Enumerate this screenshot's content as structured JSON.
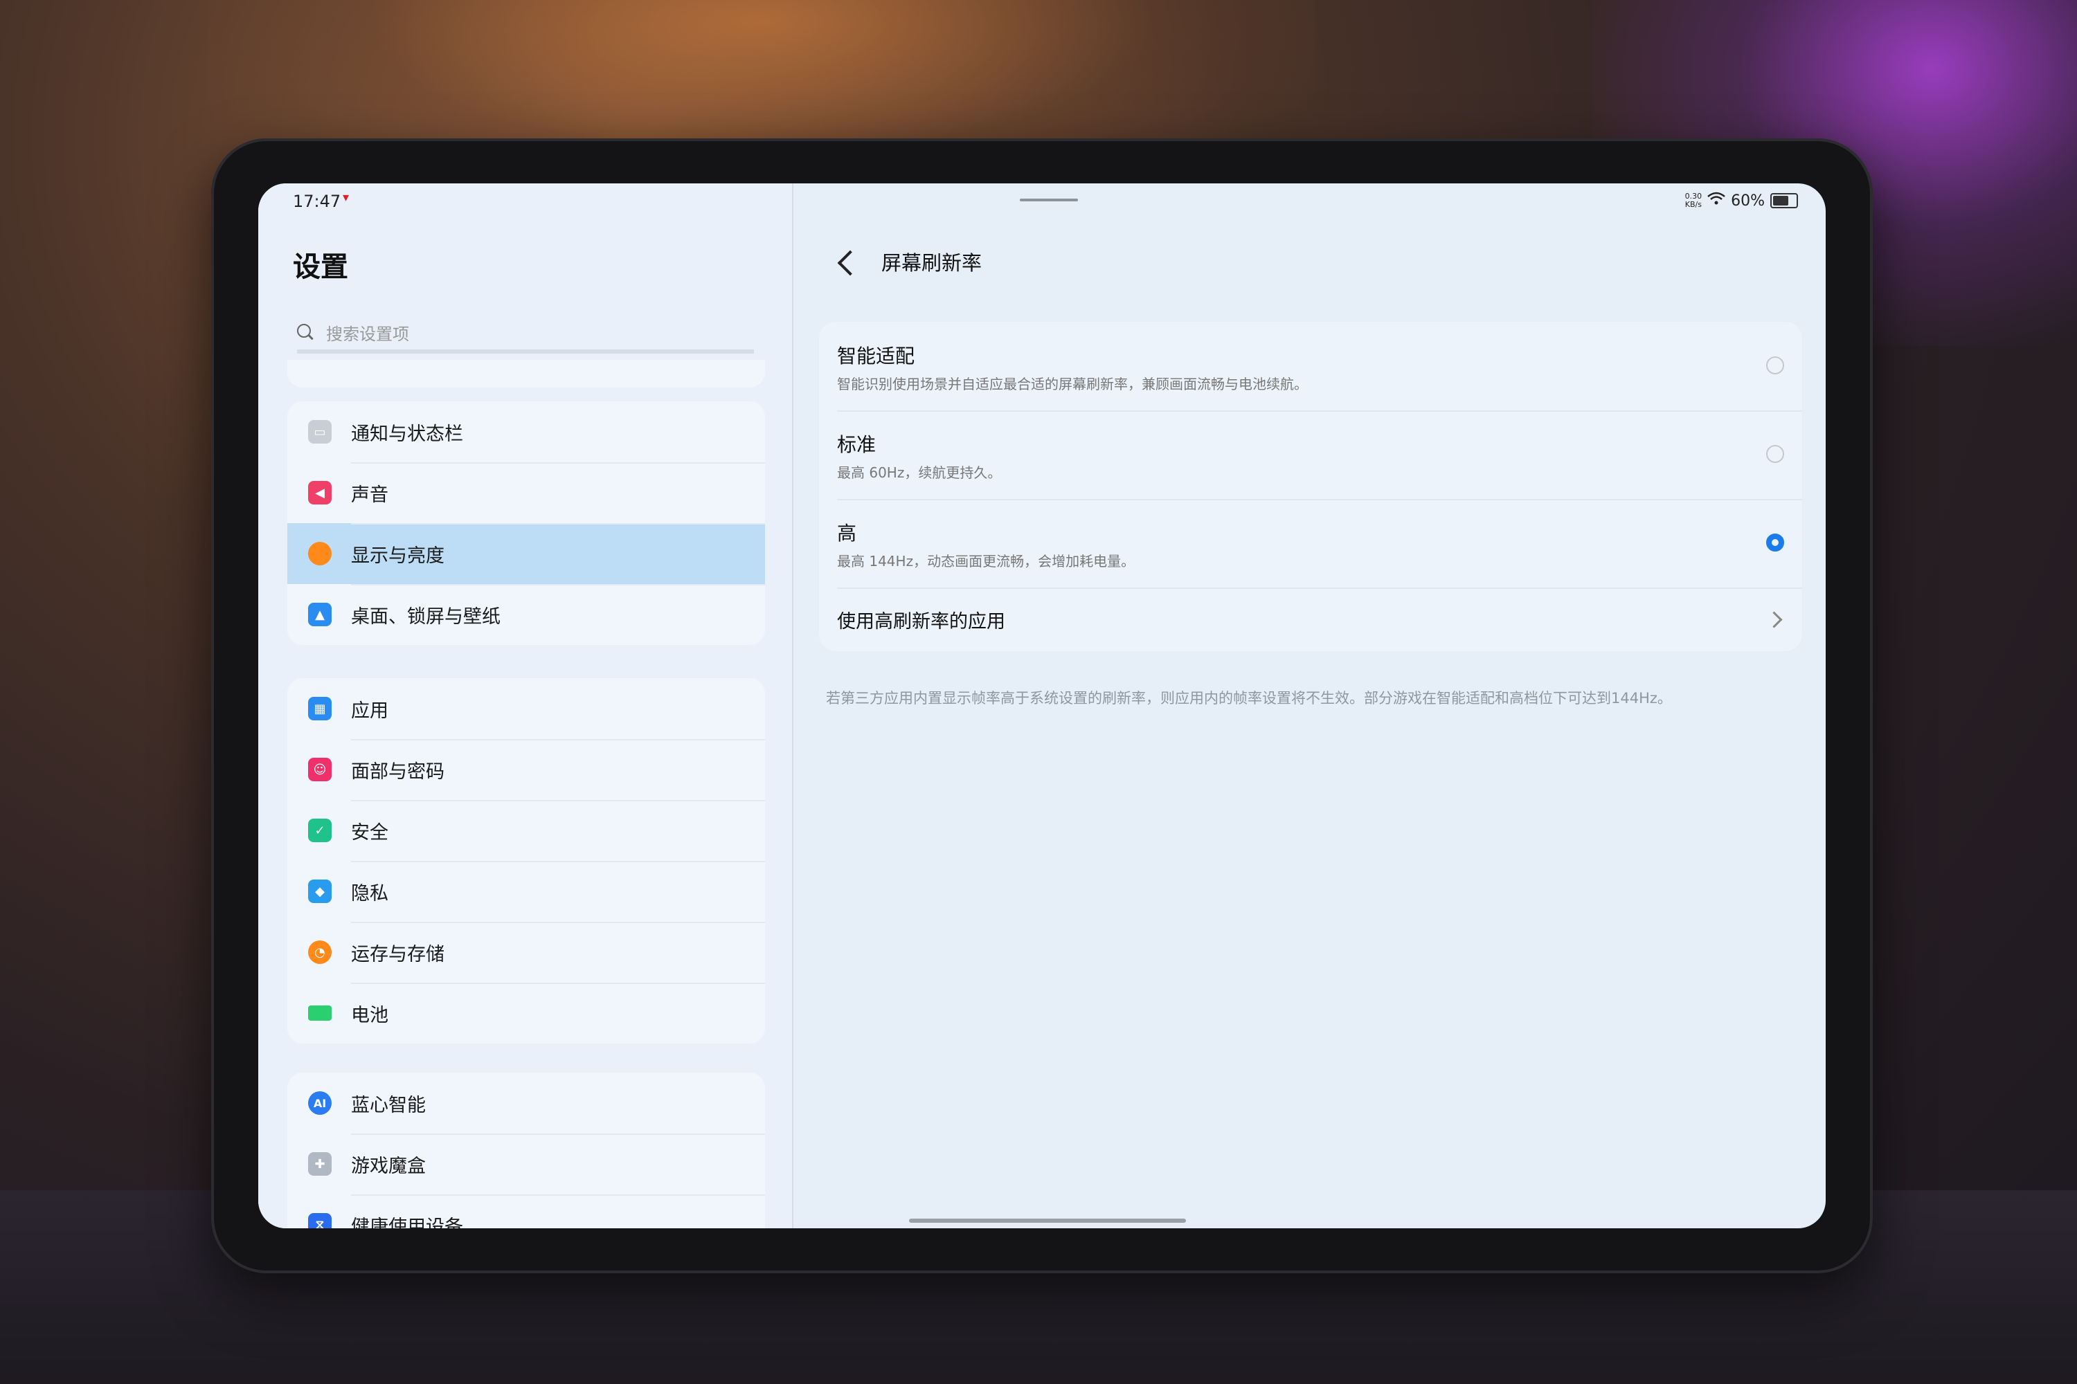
{
  "status_bar": {
    "time": "17:47",
    "net_speed_value": "0.30",
    "net_speed_unit": "KB/s",
    "battery": "60%"
  },
  "sidebar": {
    "title": "设置",
    "search_placeholder": "搜索设置项",
    "groups": [
      [
        {
          "label": "通知与状态栏",
          "icon": "notification-icon",
          "color": "#c8ced6"
        },
        {
          "label": "声音",
          "icon": "speaker-icon",
          "color": "#f0406a"
        },
        {
          "label": "显示与亮度",
          "icon": "brightness-icon",
          "color": "#ff8a1a",
          "active": true
        },
        {
          "label": "桌面、锁屏与壁纸",
          "icon": "wallpaper-icon",
          "color": "#2a8cf0"
        }
      ],
      [
        {
          "label": "应用",
          "icon": "apps-icon",
          "color": "#2a8cf0"
        },
        {
          "label": "面部与密码",
          "icon": "face-icon",
          "color": "#f0306a"
        },
        {
          "label": "安全",
          "icon": "shield-icon",
          "color": "#1ec28a"
        },
        {
          "label": "隐私",
          "icon": "privacy-icon",
          "color": "#2a9cf0"
        },
        {
          "label": "运存与存储",
          "icon": "storage-icon",
          "color": "#ff8a1a"
        },
        {
          "label": "电池",
          "icon": "battery-icon",
          "color": "#2ad070"
        }
      ],
      [
        {
          "label": "蓝心智能",
          "icon": "ai-icon",
          "color": "#2a7cf0"
        },
        {
          "label": "游戏魔盒",
          "icon": "gamepad-icon",
          "color": "#b0b8c4"
        },
        {
          "label": "健康使用设备",
          "icon": "hourglass-icon",
          "color": "#2a6cf0"
        }
      ]
    ]
  },
  "detail": {
    "title": "屏幕刷新率",
    "options": [
      {
        "title": "智能适配",
        "desc": "智能识别使用场景并自适应最合适的屏幕刷新率，兼顾画面流畅与电池续航。",
        "selected": false
      },
      {
        "title": "标准",
        "desc": "最高 60Hz，续航更持久。",
        "selected": false
      },
      {
        "title": "高",
        "desc": "最高 144Hz，动态画面更流畅，会增加耗电量。",
        "selected": true
      }
    ],
    "link_label": "使用高刷新率的应用",
    "footnote": "若第三方应用内置显示帧率高于系统设置的刷新率，则应用内的帧率设置将不生效。部分游戏在智能适配和高档位下可达到144Hz。"
  }
}
